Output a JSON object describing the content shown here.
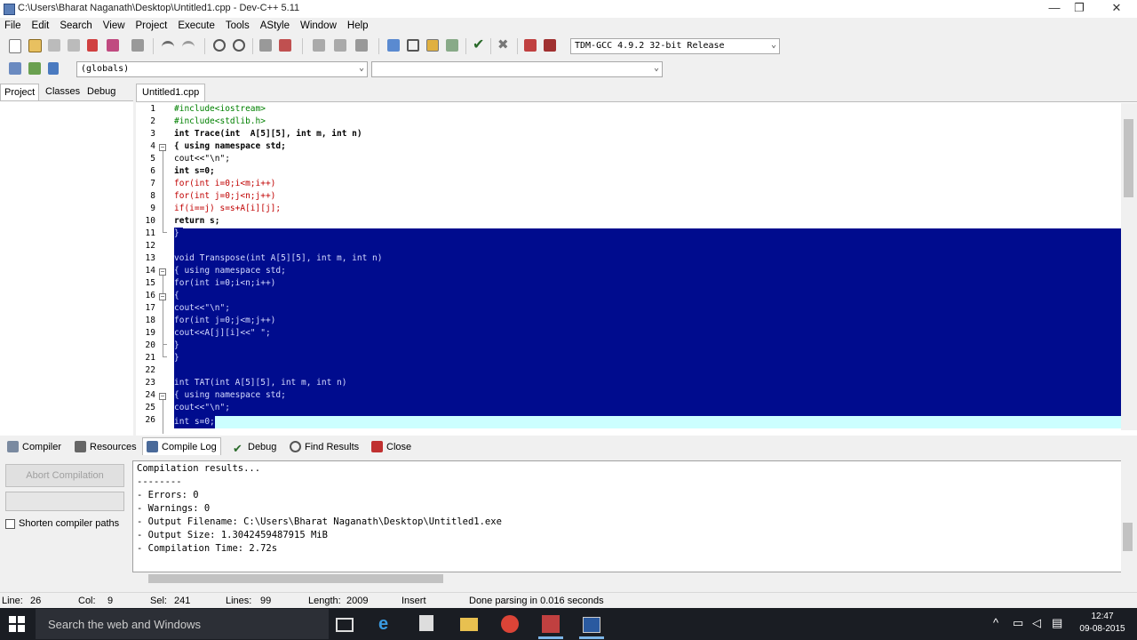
{
  "window": {
    "title": "C:\\Users\\Bharat Naganath\\Desktop\\Untitled1.cpp - Dev-C++ 5.11",
    "minimize_glyph": "—",
    "maximize_glyph": "❐",
    "close_glyph": "✕"
  },
  "menu": [
    "File",
    "Edit",
    "Search",
    "View",
    "Project",
    "Execute",
    "Tools",
    "AStyle",
    "Window",
    "Help"
  ],
  "toolbar": {
    "compiler_select": "TDM-GCC 4.9.2 32-bit Release",
    "scope_select": "(globals)",
    "members_select": ""
  },
  "left_tabs": [
    "Project",
    "Classes",
    "Debug"
  ],
  "editor_tab": "Untitled1.cpp",
  "code_lines": [
    {
      "n": "1",
      "t": "#include<iostream>"
    },
    {
      "n": "2",
      "t": "#include<stdlib.h>"
    },
    {
      "n": "3",
      "t": "int Trace(int  A[5][5], int m, int n)"
    },
    {
      "n": "4",
      "t": "{ using namespace std;"
    },
    {
      "n": "5",
      "t": "cout<<\"\\n\";"
    },
    {
      "n": "6",
      "t": "int s=0;"
    },
    {
      "n": "7",
      "t": "for(int i=0;i<m;i++)"
    },
    {
      "n": "8",
      "t": "for(int j=0;j<n;j++)"
    },
    {
      "n": "9",
      "t": "if(i==j) s=s+A[i][j];"
    },
    {
      "n": "10",
      "t": "return s;"
    },
    {
      "n": "11",
      "t": "}"
    },
    {
      "n": "12",
      "t": ""
    },
    {
      "n": "13",
      "t": "void Transpose(int A[5][5], int m, int n)"
    },
    {
      "n": "14",
      "t": "{ using namespace std;"
    },
    {
      "n": "15",
      "t": "for(int i=0;i<n;i++)"
    },
    {
      "n": "16",
      "t": "{"
    },
    {
      "n": "17",
      "t": "cout<<\"\\n\";"
    },
    {
      "n": "18",
      "t": "for(int j=0;j<m;j++)"
    },
    {
      "n": "19",
      "t": "cout<<A[j][i]<<\" \";"
    },
    {
      "n": "20",
      "t": "}"
    },
    {
      "n": "21",
      "t": "}"
    },
    {
      "n": "22",
      "t": ""
    },
    {
      "n": "23",
      "t": "int TAT(int A[5][5], int m, int n)"
    },
    {
      "n": "24",
      "t": "{ using namespace std;"
    },
    {
      "n": "25",
      "t": "cout<<\"\\n\";"
    },
    {
      "n": "26",
      "t": "int s=0;"
    }
  ],
  "bottom_tabs": [
    "Compiler",
    "Resources",
    "Compile Log",
    "Debug",
    "Find Results",
    "Close"
  ],
  "compile": {
    "abort_label": "Abort Compilation",
    "shorten_label": "Shorten compiler paths",
    "log": [
      "Compilation results...",
      "--------",
      "- Errors: 0",
      "- Warnings: 0",
      "- Output Filename: C:\\Users\\Bharat Naganath\\Desktop\\Untitled1.exe",
      "- Output Size: 1.3042459487915 MiB",
      "- Compilation Time: 2.72s"
    ]
  },
  "status": {
    "line_label": "Line:",
    "line": "26",
    "col_label": "Col:",
    "col": "9",
    "sel_label": "Sel:",
    "sel": "241",
    "lines_label": "Lines:",
    "lines": "99",
    "length_label": "Length:",
    "length": "2009",
    "mode": "Insert",
    "message": "Done parsing in 0.016 seconds"
  },
  "taskbar": {
    "search_placeholder": "Search the web and Windows",
    "time": "12:47",
    "date": "09-08-2015"
  },
  "colors": {
    "selection": "#000c8e",
    "current_line": "#ccffff",
    "taskbar": "#1a1d23"
  }
}
